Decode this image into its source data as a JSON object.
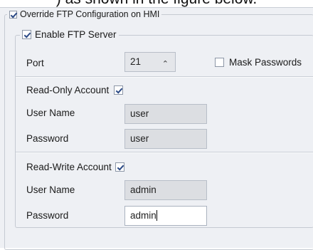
{
  "caption": ") as shown in the figure below.",
  "override": {
    "label": "Override FTP Configuration on HMI",
    "checked": true
  },
  "ftp": {
    "enable_label": "Enable FTP Server",
    "enabled": true,
    "port_label": "Port",
    "port_value": "21",
    "mask_label": "Mask Passwords",
    "mask_checked": false
  },
  "read_only": {
    "label": "Read-Only Account",
    "checked": true,
    "user_label": "User Name",
    "user_value": "user",
    "password_label": "Password",
    "password_value": "user"
  },
  "read_write": {
    "label": "Read-Write Account",
    "checked": true,
    "user_label": "User Name",
    "user_value": "admin",
    "password_label": "Password",
    "password_value": "admin"
  },
  "icons": {
    "spin_up": "chevron-up-icon"
  }
}
